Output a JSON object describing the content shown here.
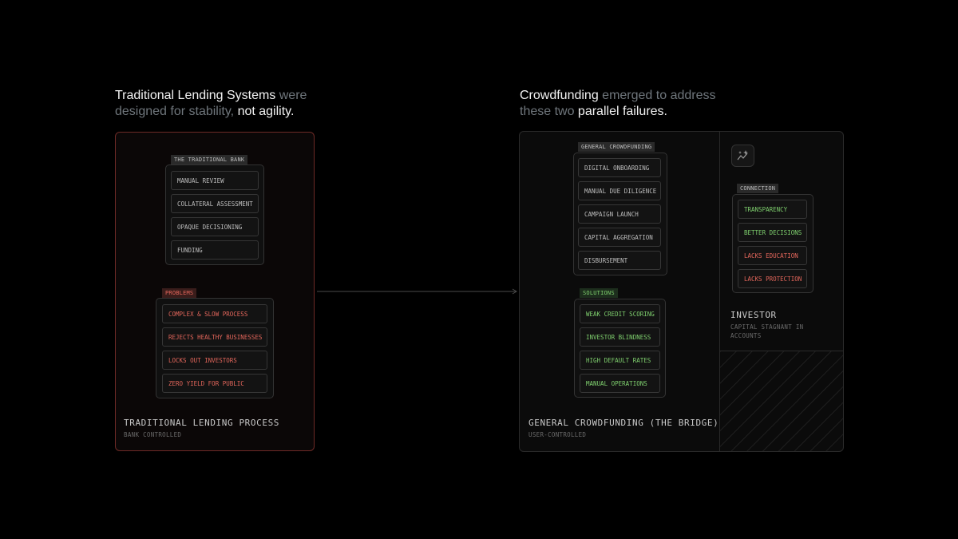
{
  "left_heading": {
    "line1_white": "Traditional Lending Systems",
    "line1_gray": " were",
    "line2_gray": "designed for stability,",
    "line2_white": " not agility."
  },
  "right_heading": {
    "line1_white": "Crowdfunding",
    "line1_gray": " emerged to address",
    "line2_gray": "these two",
    "line2_white": " parallel failures."
  },
  "traditional": {
    "bank_tag": "THE TRADITIONAL BANK",
    "bank_items": [
      "MANUAL REVIEW",
      "COLLATERAL ASSESSMENT",
      "OPAQUE DECISIONING",
      "FUNDING"
    ],
    "problems_tag": "PROBLEMS",
    "problem_items": [
      "COMPLEX & SLOW PROCESS",
      "REJECTS HEALTHY BUSINESSES",
      "LOCKS OUT INVESTORS",
      "ZERO YIELD FOR PUBLIC"
    ],
    "title": "TRADITIONAL LENDING PROCESS",
    "subtitle": "BANK CONTROLLED"
  },
  "crowdfunding": {
    "general_tag": "GENERAL CROWDFUNDING",
    "general_items": [
      "DIGITAL ONBOARDING",
      "MANUAL DUE DILIGENCE",
      "CAMPAIGN LAUNCH",
      "CAPITAL AGGREGATION",
      "DISBURSEMENT"
    ],
    "solutions_tag": "SOLUTIONS",
    "solution_items": [
      "WEAK CREDIT SCORING",
      "INVESTOR BLINDNESS",
      "HIGH DEFAULT RATES",
      "MANUAL OPERATIONS"
    ],
    "title": "GENERAL CROWDFUNDING (THE BRIDGE)",
    "subtitle": "USER-CONTROLLED"
  },
  "investor": {
    "icon": "sparkle-chart-icon",
    "connection_tag": "CONNECTION",
    "connection_items": [
      {
        "label": "TRANSPARENCY",
        "status": "good"
      },
      {
        "label": "BETTER DECISIONS",
        "status": "good"
      },
      {
        "label": "LACKS EDUCATION",
        "status": "bad"
      },
      {
        "label": "LACKS PROTECTION",
        "status": "bad"
      }
    ],
    "title": "INVESTOR",
    "subtitle_line1": "CAPITAL STAGNANT IN",
    "subtitle_line2": "ACCOUNTS"
  },
  "colors": {
    "background": "#000000",
    "good": "#7fd06e",
    "bad": "#e3665b",
    "left_border": "#6e2a26"
  }
}
